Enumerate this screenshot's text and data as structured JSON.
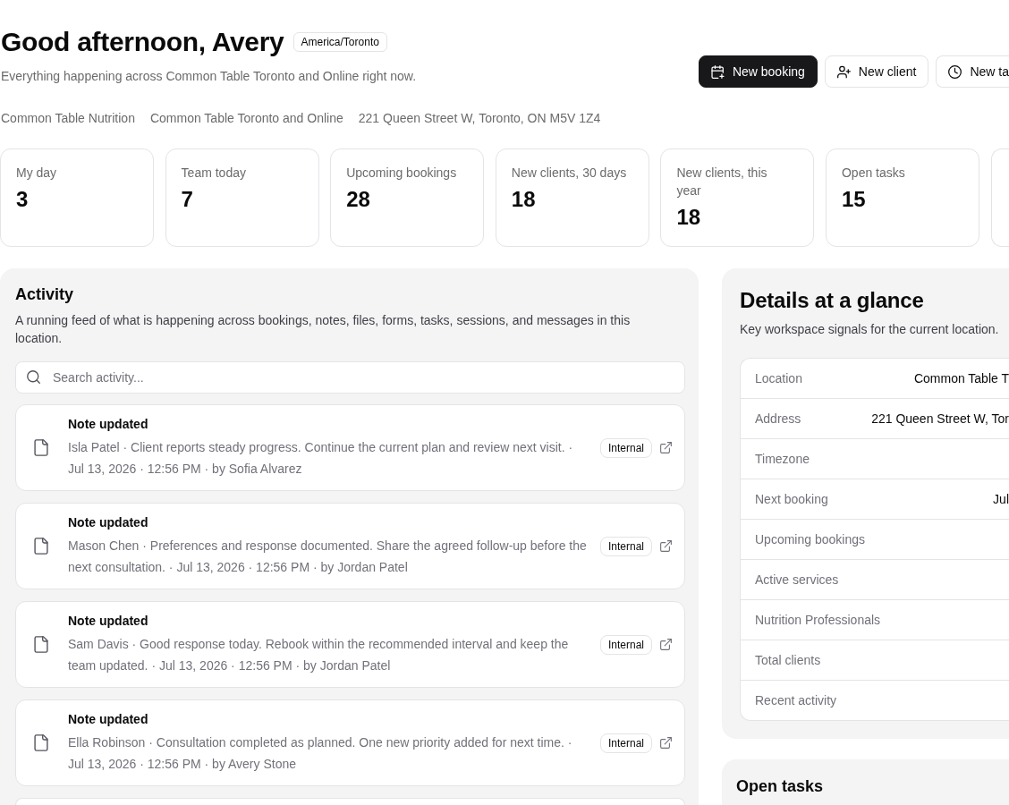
{
  "header": {
    "greeting": "Good afternoon, Avery",
    "timezone_badge": "America/Toronto",
    "subtitle": "Everything happening across Common Table Toronto and Online right now.",
    "actions": [
      {
        "kind": "booking",
        "label": "New booking",
        "primary": true
      },
      {
        "kind": "client",
        "label": "New client",
        "primary": false
      },
      {
        "kind": "task",
        "label": "New ta",
        "primary": false
      }
    ]
  },
  "meta": [
    "Common Table Nutrition",
    "Common Table Toronto and Online",
    "221 Queen Street W, Toronto, ON M5V 1Z4"
  ],
  "stats": [
    {
      "label": "My day",
      "value": "3"
    },
    {
      "label": "Team today",
      "value": "7"
    },
    {
      "label": "Upcoming bookings",
      "value": "28"
    },
    {
      "label": "New clients, 30 days",
      "value": "18"
    },
    {
      "label": "New clients, this year",
      "value": "18"
    },
    {
      "label": "Open tasks",
      "value": "15"
    }
  ],
  "activity": {
    "title": "Activity",
    "description": "A running feed of what is happening across bookings, notes, files, forms, tasks, sessions, and messages in this location.",
    "search": {
      "placeholder": "Search activity..."
    },
    "items": [
      {
        "kind": "note",
        "title": "Note updated",
        "detail": "Isla Patel · Client reports steady progress. Continue the current plan and review next visit. · Jul 13, 2026 · 12:56 PM · by Sofia Alvarez",
        "badge": "Internal"
      },
      {
        "kind": "note",
        "title": "Note updated",
        "detail": "Mason Chen · Preferences and response documented. Share the agreed follow-up before the next consultation. · Jul 13, 2026 · 12:56 PM · by Jordan Patel",
        "badge": "Internal"
      },
      {
        "kind": "note",
        "title": "Note updated",
        "detail": "Sam Davis · Good response today. Rebook within the recommended interval and keep the team updated. · Jul 13, 2026 · 12:56 PM · by Jordan Patel",
        "badge": "Internal"
      },
      {
        "kind": "note",
        "title": "Note updated",
        "detail": "Ella Robinson · Consultation completed as planned. One new priority added for next time. · Jul 13, 2026 · 12:56 PM · by Avery Stone",
        "badge": "Internal"
      }
    ]
  },
  "details": {
    "title": "Details at a glance",
    "subtitle": "Key workspace signals for the current location.",
    "rows": [
      {
        "label": "Location",
        "value": "Common Table T"
      },
      {
        "label": "Address",
        "value": "221 Queen Street W, Tor"
      },
      {
        "label": "Timezone"
      },
      {
        "label": "Next booking",
        "value": "Jul"
      },
      {
        "label": "Upcoming bookings"
      },
      {
        "label": "Active services"
      },
      {
        "label": "Nutrition Professionals"
      },
      {
        "label": "Total clients"
      },
      {
        "label": "Recent activity"
      }
    ]
  },
  "open_tasks": {
    "title": "Open tasks"
  }
}
